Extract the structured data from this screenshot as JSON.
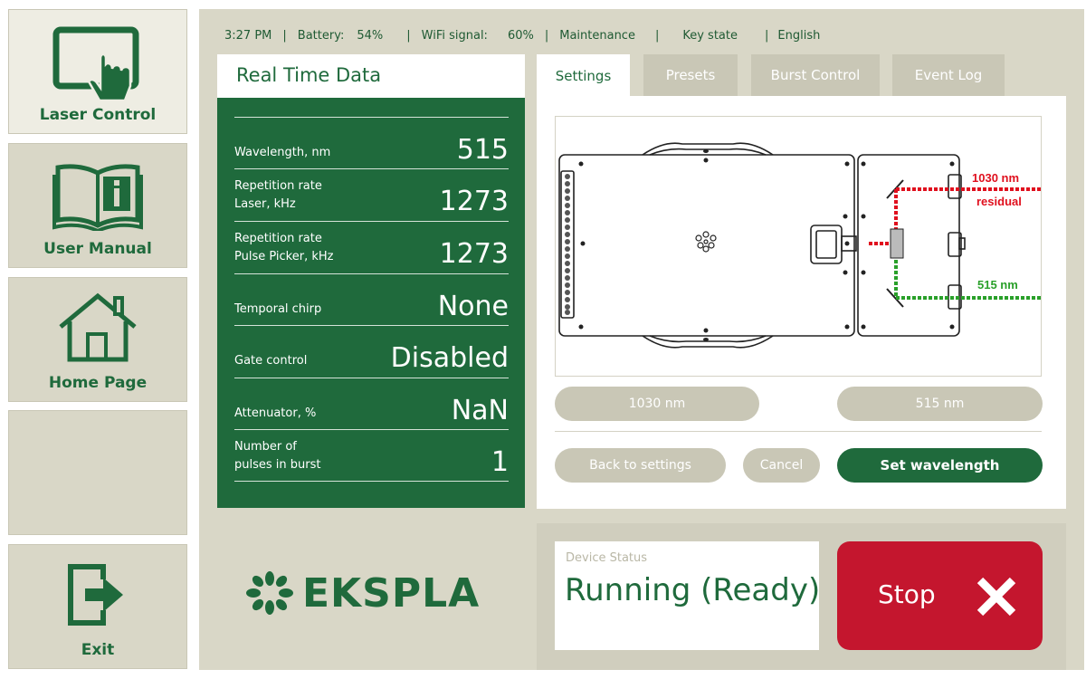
{
  "nav": {
    "items": [
      {
        "label": "Laser Control",
        "icon": "touch-screen-icon"
      },
      {
        "label": "User Manual",
        "icon": "manual-book-icon"
      },
      {
        "label": "Home Page",
        "icon": "home-icon"
      },
      {
        "label": "",
        "icon": ""
      },
      {
        "label": "Exit",
        "icon": "exit-icon"
      }
    ]
  },
  "status_bar": {
    "time": "3:27 PM",
    "battery_label": "Battery:",
    "battery_value": "54%",
    "wifi_label": "WiFi signal:",
    "wifi_value": "60%",
    "maintenance": "Maintenance",
    "key_state": "Key state",
    "language": "English"
  },
  "realtime": {
    "title": "Real Time Data",
    "rows": [
      {
        "label": "Wavelength, nm",
        "value": "515"
      },
      {
        "label": "Repetition rate\nLaser, kHz",
        "value": "1273"
      },
      {
        "label": "Repetition rate\nPulse Picker, kHz",
        "value": "1273"
      },
      {
        "label": "Temporal chirp",
        "value": "None"
      },
      {
        "label": "Gate control",
        "value": "Disabled"
      },
      {
        "label": "Attenuator, %",
        "value": "NaN"
      },
      {
        "label": "Number of\npulses in burst",
        "value": "1"
      }
    ]
  },
  "tabs": [
    {
      "label": "Settings",
      "active": true
    },
    {
      "label": "Presets",
      "active": false
    },
    {
      "label": "Burst Control",
      "active": false
    },
    {
      "label": "Event Log",
      "active": false
    }
  ],
  "diagram": {
    "label_1030": "1030 nm",
    "label_residual": "residual",
    "label_515": "515 nm"
  },
  "settings": {
    "btn_1030": "1030 nm",
    "btn_515": "515 nm",
    "back": "Back to settings",
    "cancel": "Cancel",
    "set_wavelength": "Set wavelength"
  },
  "logo": {
    "text": "EKSPLA"
  },
  "device_status": {
    "label": "Device Status",
    "value": "Running (Ready)"
  },
  "stop": {
    "label": "Stop"
  },
  "colors": {
    "brand_green": "#1f6a3c",
    "panel_beige": "#d9d7c7",
    "stop_red": "#c4162e",
    "beam_red": "#e0101e",
    "beam_green": "#2aa02a"
  }
}
